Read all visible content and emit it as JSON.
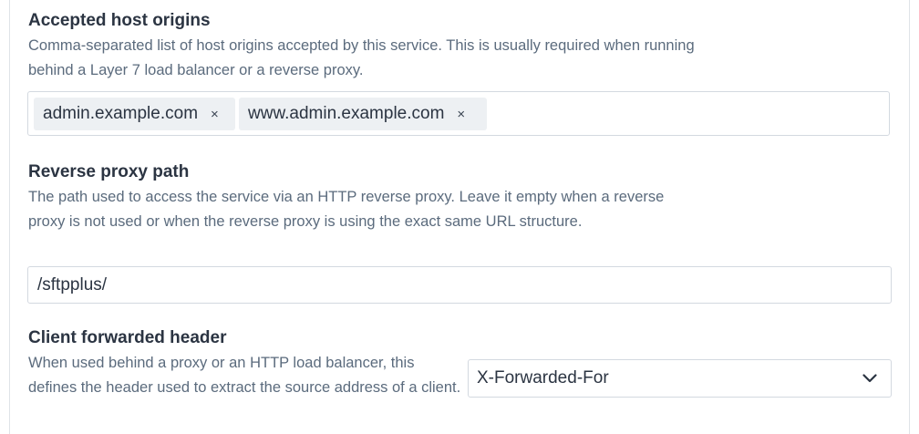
{
  "accepted_host_origins": {
    "title": "Accepted host origins",
    "description": "Comma-separated list of host origins accepted by this service. This is usually required when running behind a Layer 7 load balancer or a reverse proxy.",
    "tags": [
      {
        "label": "admin.example.com",
        "remove": "×"
      },
      {
        "label": "www.admin.example.com",
        "remove": "×"
      }
    ]
  },
  "reverse_proxy_path": {
    "title": "Reverse proxy path",
    "description": "The path used to access the service via an HTTP reverse proxy. Leave it empty when a reverse proxy is not used or when the reverse proxy is using the exact same URL structure.",
    "value": "/sftpplus/"
  },
  "client_forwarded_header": {
    "title": "Client forwarded header",
    "description": "When used behind a proxy or an HTTP load balancer, this defines the header used to extract the source address of a client.",
    "selected": "X-Forwarded-For",
    "icon": "chevron-down-icon"
  }
}
